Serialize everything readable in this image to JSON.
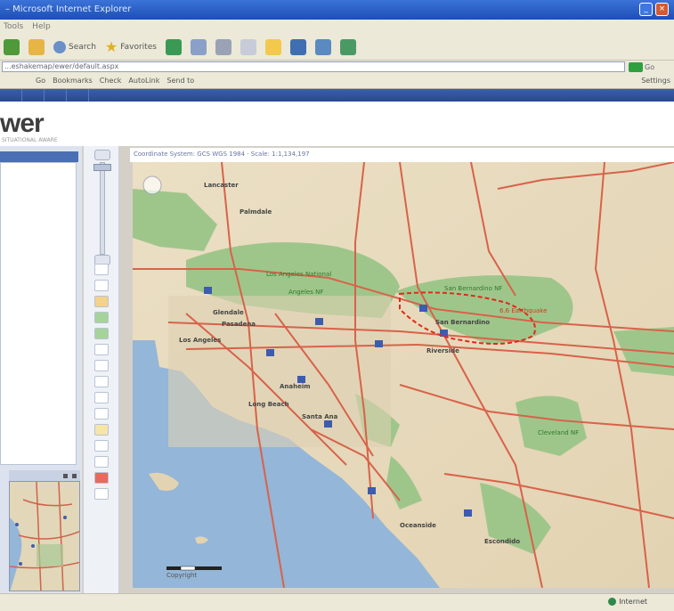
{
  "window": {
    "title": "– Microsoft Internet Explorer"
  },
  "menubar": {
    "items": [
      "Tools",
      "Help"
    ]
  },
  "toolbar": {
    "search_label": "Search",
    "favorites_label": "Favorites"
  },
  "address": {
    "value": "...eshakemap/ewer/default.aspx",
    "go_label": "Go"
  },
  "google_bar": {
    "items": [
      "Go",
      "Bookmarks",
      "Check",
      "AutoLink",
      "Send to"
    ],
    "settings_label": "Settings"
  },
  "nav_tabs": [
    "",
    "",
    "",
    ""
  ],
  "header": {
    "logo": "wer",
    "logo_sub": "SITUATIONAL AWARE",
    "user_links_1": "",
    "user_links_2": ""
  },
  "map": {
    "coordinate_line": "Coordinate System: GCS WGS 1984 · Scale: 1:1,134,197",
    "scale_label": "Copyright",
    "labels": {
      "lancaster": "Lancaster",
      "palmdale": "Palmdale",
      "angeles_nf_1": "Los Angeles National",
      "angeles_nf_2": "Angeles NF",
      "sb_nf": "San Bernardino NF",
      "quake": "6.6 Earthquake",
      "san_bernardino": "San Bernardino",
      "los_angeles": "Los Angeles",
      "pasadena": "Pasadena",
      "glendale": "Glendale",
      "long_beach": "Long Beach",
      "anaheim": "Anaheim",
      "santa_ana": "Santa Ana",
      "riverside": "Riverside",
      "oceanside": "Oceanside",
      "escondido": "Escondido",
      "cleveland_nf": "Cleveland NF"
    }
  },
  "status": {
    "zone": "Internet"
  },
  "colors": {
    "water": "#94b6d8",
    "land": "#e8dcc0",
    "forest": "#9fc68a",
    "road": "#d8624a",
    "quake_outline": "#e12a1a"
  }
}
